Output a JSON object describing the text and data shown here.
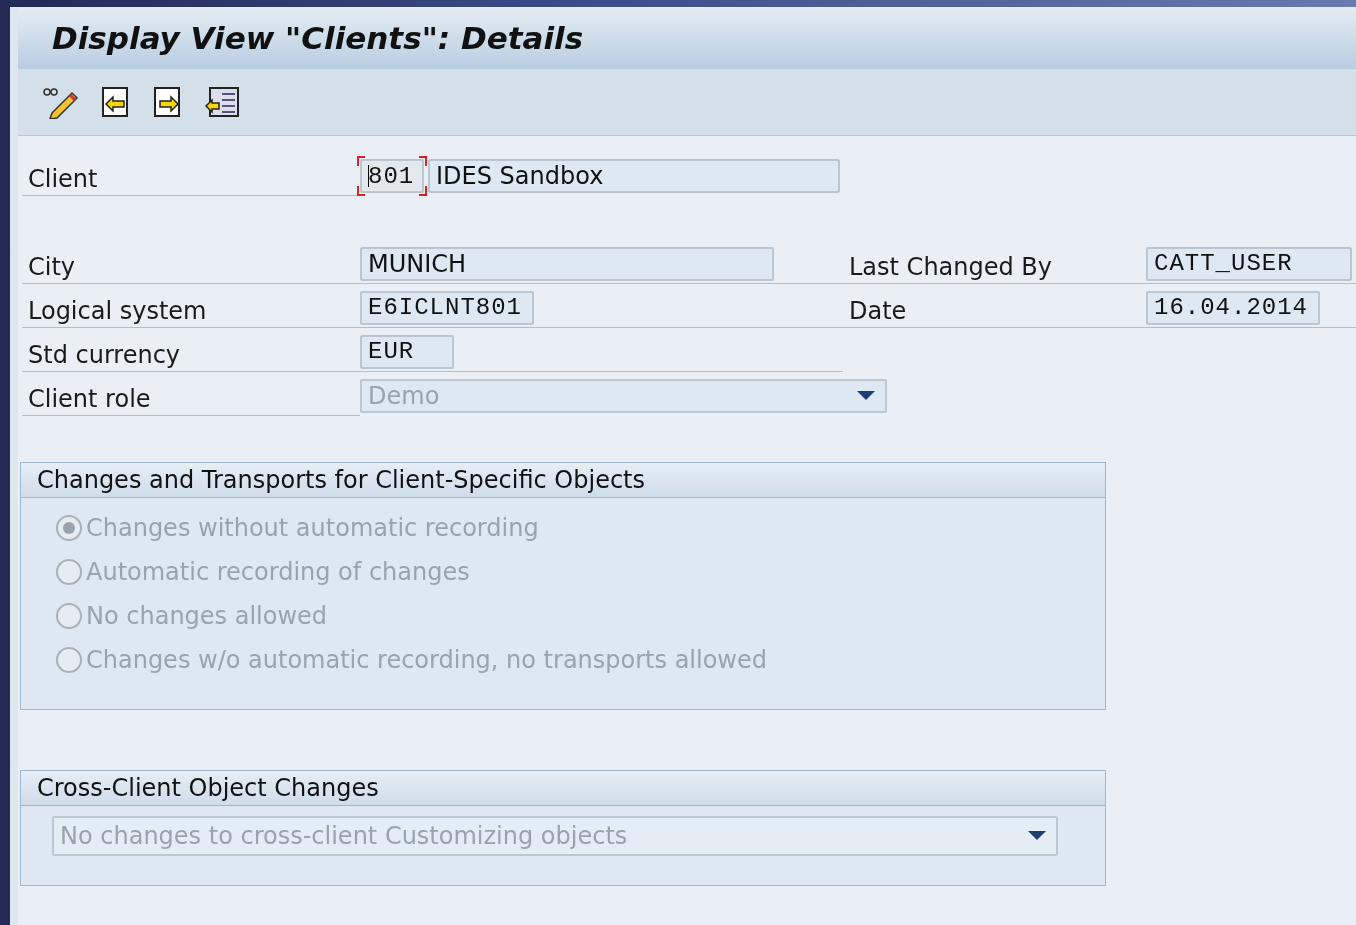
{
  "title": "Display View \"Clients\": Details",
  "client": {
    "label": "Client",
    "number": "801",
    "description": "IDES Sandbox"
  },
  "fields_left": [
    {
      "label": "City",
      "value": "MUNICH",
      "mono": false
    },
    {
      "label": "Logical system",
      "value": "E6ICLNT801",
      "mono": true
    },
    {
      "label": "Std currency",
      "value": "EUR",
      "mono": true
    }
  ],
  "fields_right": [
    {
      "label": "Last Changed By",
      "value": "CATT_USER"
    },
    {
      "label": "Date",
      "value": "16.04.2014"
    }
  ],
  "client_role": {
    "label": "Client role",
    "value": "Demo",
    "disabled": true
  },
  "transports_group": {
    "title": "Changes and Transports for Client-Specific Objects",
    "disabled": true,
    "options": [
      {
        "label": "Changes without automatic recording",
        "selected": true
      },
      {
        "label": "Automatic recording of changes",
        "selected": false
      },
      {
        "label": "No changes allowed",
        "selected": false
      },
      {
        "label": "Changes w/o automatic recording, no transports allowed",
        "selected": false
      }
    ]
  },
  "cross_client_group": {
    "title": "Cross-Client Object Changes",
    "value": "No changes to cross-client Customizing objects",
    "disabled": true
  }
}
